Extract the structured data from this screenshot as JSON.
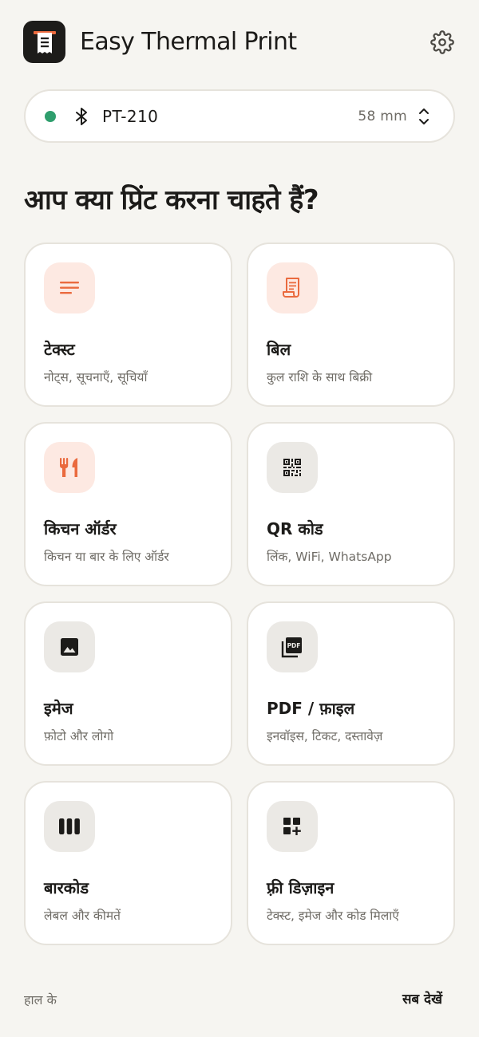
{
  "app": {
    "title": "Easy Thermal Print"
  },
  "printer": {
    "name": "PT-210",
    "paper_size": "58 mm",
    "connected_color": "#2f9e6d"
  },
  "heading": "आप क्या प्रिंट करना चाहते हैं?",
  "accent_color": "#ea6a3e",
  "cards": [
    {
      "title": "टेक्स्ट",
      "subtitle": "नोट्स, सूचनाएँ, सूचियाँ",
      "icon": "text-lines-icon"
    },
    {
      "title": "बिल",
      "subtitle": "कुल राशि के साथ बिक्री",
      "icon": "receipt-icon"
    },
    {
      "title": "किचन ऑर्डर",
      "subtitle": "किचन या बार के लिए ऑर्डर",
      "icon": "fork-knife-icon"
    },
    {
      "title": "QR कोड",
      "subtitle": "लिंक, WiFi, WhatsApp",
      "icon": "qr-code-icon"
    },
    {
      "title": "इमेज",
      "subtitle": "फ़ोटो और लोगो",
      "icon": "image-icon"
    },
    {
      "title": "PDF / फ़ाइल",
      "subtitle": "इनवॉइस, टिकट, दस्तावेज़",
      "icon": "pdf-icon"
    },
    {
      "title": "बारकोड",
      "subtitle": "लेबल और कीमतें",
      "icon": "barcode-icon"
    },
    {
      "title": "फ़्री डिज़ाइन",
      "subtitle": "टेक्स्ट, इमेज और कोड मिलाएँ",
      "icon": "add-widgets-icon"
    }
  ],
  "recent": {
    "label": "हाल के",
    "see_all": "सब देखें"
  }
}
